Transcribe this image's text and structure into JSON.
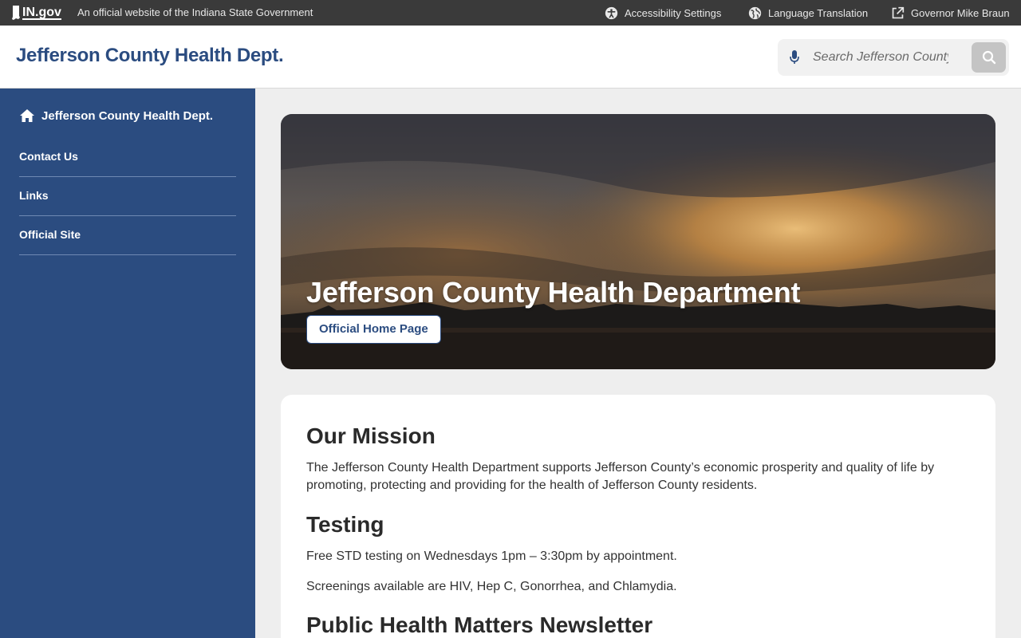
{
  "govbar": {
    "logo_text": "IN.gov",
    "official_text": "An official website of the Indiana State Government",
    "links": [
      {
        "label": "Accessibility Settings",
        "icon": "accessibility-icon"
      },
      {
        "label": "Language Translation",
        "icon": "globe-icon"
      },
      {
        "label": "Governor Mike Braun",
        "icon": "external-link-icon"
      }
    ]
  },
  "header": {
    "title": "Jefferson County Health Dept.",
    "search": {
      "placeholder": "Search Jefferson County Health Dept.",
      "value": "",
      "mic_icon": "microphone-icon",
      "submit_icon": "search-icon"
    }
  },
  "sidebar": {
    "home": {
      "label": "Jefferson County Health Dept.",
      "icon": "home-icon"
    },
    "items": [
      {
        "label": "Contact Us"
      },
      {
        "label": "Links"
      },
      {
        "label": "Official Site"
      }
    ]
  },
  "hero": {
    "title": "Jefferson County Health Department",
    "button_label": "Official Home Page"
  },
  "content": {
    "mission_heading": "Our Mission",
    "mission_text": "The Jefferson County Health Department supports Jefferson County’s economic prosperity and quality of life by promoting, protecting and providing for the health of Jefferson County residents.",
    "testing_heading": "Testing",
    "testing_text_1": "Free STD testing on Wednesdays 1pm – 3:30pm by appointment.",
    "testing_text_2": "Screenings available are HIV, Hep C, Gonorrhea, and Chlamydia.",
    "newsletter_heading": "Public Health Matters Newsletter"
  },
  "colors": {
    "brand_blue": "#2b4c80",
    "gov_bar": "#3a3a3a",
    "page_bg": "#eeeeee"
  }
}
